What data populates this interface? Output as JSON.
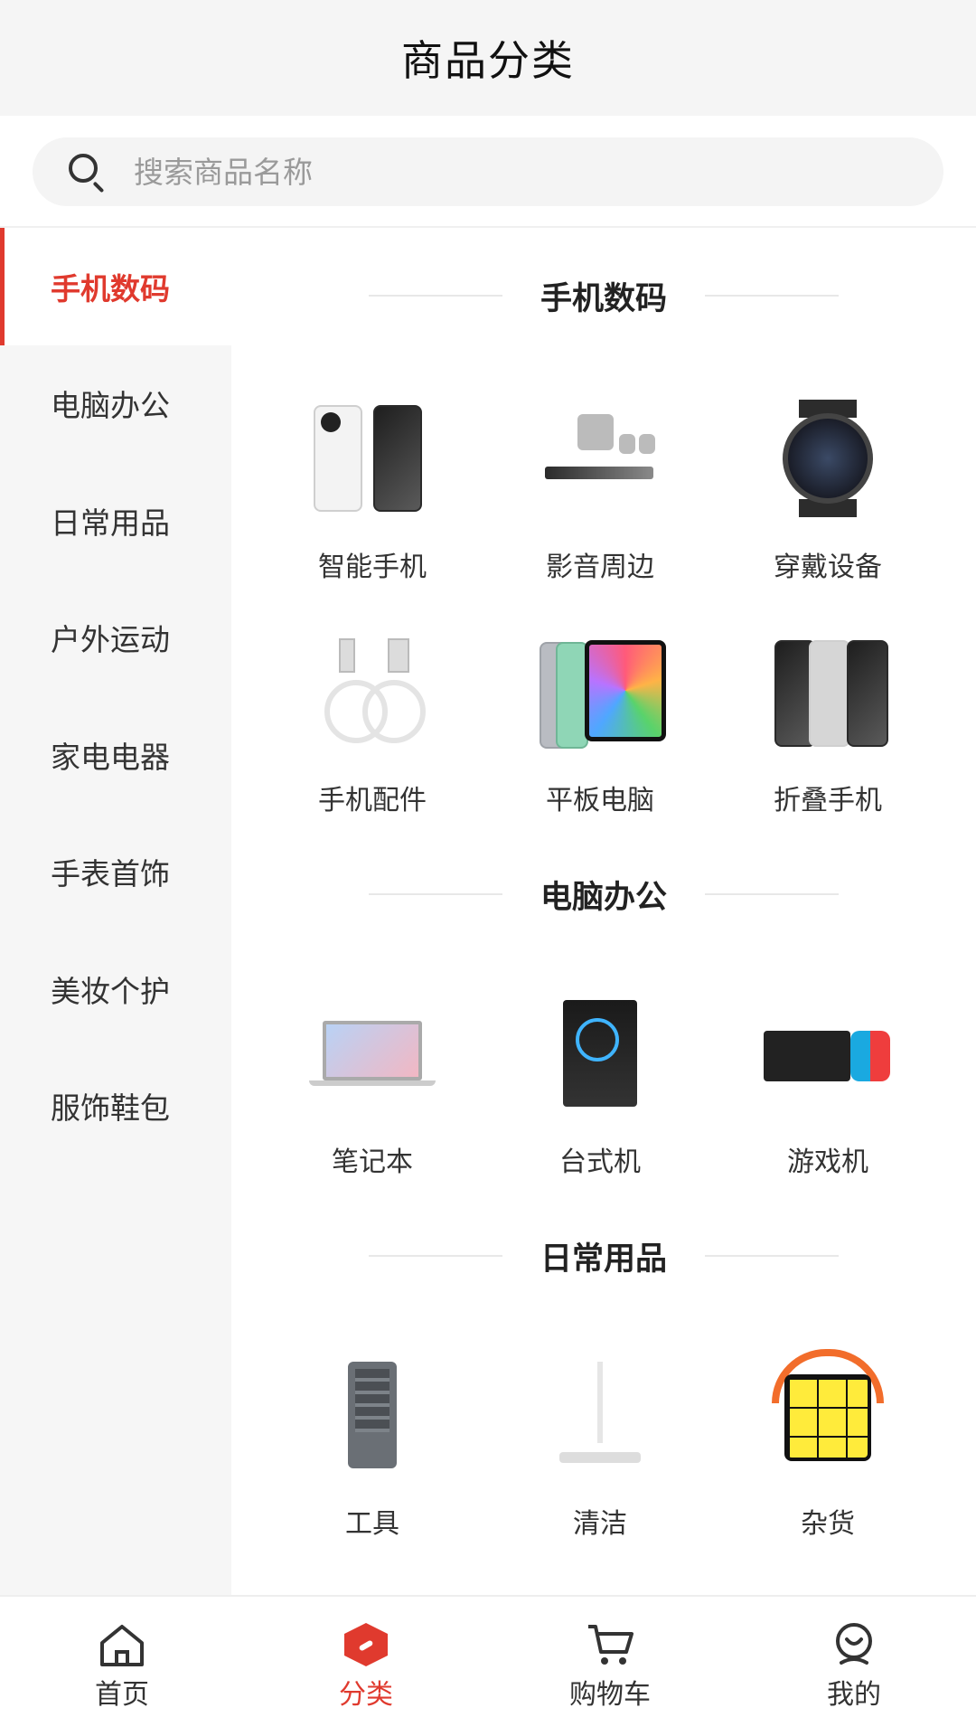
{
  "header": {
    "title": "商品分类"
  },
  "search": {
    "placeholder": "搜索商品名称"
  },
  "sidebar": {
    "items": [
      {
        "label": "手机数码",
        "active": true
      },
      {
        "label": "电脑办公"
      },
      {
        "label": "日常用品"
      },
      {
        "label": "户外运动"
      },
      {
        "label": "家电电器"
      },
      {
        "label": "手表首饰"
      },
      {
        "label": "美妆个护"
      },
      {
        "label": "服饰鞋包"
      }
    ]
  },
  "sections": [
    {
      "title": "手机数码",
      "items": [
        {
          "label": "智能手机",
          "icon": "smartphone-icon"
        },
        {
          "label": "影音周边",
          "icon": "speaker-icon"
        },
        {
          "label": "穿戴设备",
          "icon": "smartwatch-icon"
        },
        {
          "label": "手机配件",
          "icon": "usb-cable-icon"
        },
        {
          "label": "平板电脑",
          "icon": "tablet-icon"
        },
        {
          "label": "折叠手机",
          "icon": "foldable-phone-icon"
        }
      ]
    },
    {
      "title": "电脑办公",
      "items": [
        {
          "label": "笔记本",
          "icon": "laptop-icon"
        },
        {
          "label": "台式机",
          "icon": "desktop-icon"
        },
        {
          "label": "游戏机",
          "icon": "game-console-icon"
        }
      ]
    },
    {
      "title": "日常用品",
      "items": [
        {
          "label": "工具",
          "icon": "toolkit-icon"
        },
        {
          "label": "清洁",
          "icon": "mop-icon"
        },
        {
          "label": "杂货",
          "icon": "rubiks-cube-icon"
        }
      ]
    }
  ],
  "tabbar": {
    "items": [
      {
        "label": "首页",
        "icon": "home-icon"
      },
      {
        "label": "分类",
        "icon": "category-icon",
        "active": true
      },
      {
        "label": "购物车",
        "icon": "cart-icon"
      },
      {
        "label": "我的",
        "icon": "profile-icon"
      }
    ]
  },
  "colors": {
    "accent": "#e03a2e",
    "sidebar_bg": "#f6f6f6",
    "header_bg": "#f5f5f5"
  }
}
